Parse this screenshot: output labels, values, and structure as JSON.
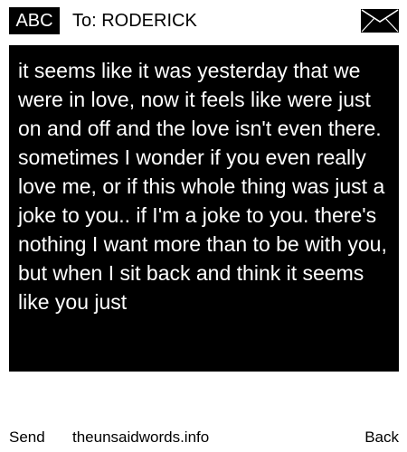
{
  "header": {
    "badge_label": "ABC",
    "recipient_text": "To: RODERICK",
    "envelope_icon": "envelope-icon"
  },
  "message": {
    "body": "it seems like it was yesterday that we were in love, now it feels like were just on and off and the love isn't even there. sometimes I wonder if you even really love me, or if this whole thing was just a joke to you.. if I'm a joke to you. there's nothing I want more than to be with you, but when I sit back and think it seems like you just"
  },
  "footer": {
    "send_label": "Send",
    "site_label": "theunsaidwords.info",
    "back_label": "Back"
  },
  "colors": {
    "background": "#ffffff",
    "foreground": "#000000"
  }
}
